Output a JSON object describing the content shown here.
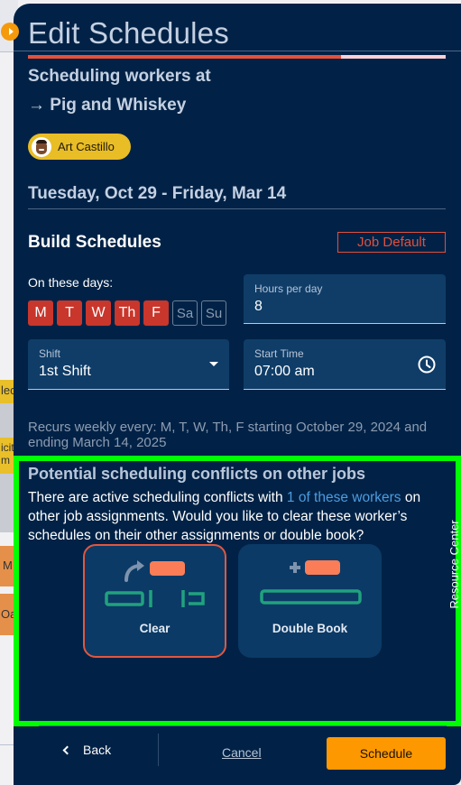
{
  "background": {
    "fragments": [
      "lec",
      "icit",
      "m",
      "M",
      "Oa"
    ]
  },
  "panel": {
    "title": "Edit Schedules",
    "progress_percent": 75,
    "subtitle_line1": "Scheduling workers at",
    "subtitle_line2": "→ Pig and Whiskey",
    "worker_chip": {
      "name": "Art Castillo"
    },
    "date_range": "Tuesday, Oct 29 - Friday, Mar 14"
  },
  "build": {
    "title": "Build Schedules",
    "job_default_label": "Job Default",
    "days_label": "On these days:",
    "days": [
      {
        "label": "M",
        "selected": true
      },
      {
        "label": "T",
        "selected": true
      },
      {
        "label": "W",
        "selected": true
      },
      {
        "label": "Th",
        "selected": true
      },
      {
        "label": "F",
        "selected": true
      },
      {
        "label": "Sa",
        "selected": false
      },
      {
        "label": "Su",
        "selected": false
      }
    ],
    "hours_per_day": {
      "label": "Hours per day",
      "value": "8"
    },
    "shift": {
      "label": "Shift",
      "value": "1st Shift"
    },
    "start_time": {
      "label": "Start Time",
      "value": "07:00 am"
    },
    "recurs_text": "Recurs weekly every: M, T, W, Th, F starting October 29, 2024 and ending March 14, 2025"
  },
  "conflicts": {
    "title": "Potential scheduling conflicts on other jobs",
    "text_before": "There are active scheduling conflicts with ",
    "link_text": "1 of these workers",
    "text_after": " on other job assignments. Would you like to clear these worker’s schedules on their other assignments or double book?",
    "options": [
      {
        "label": "Clear",
        "selected": true
      },
      {
        "label": "Double Book",
        "selected": false
      }
    ]
  },
  "resource_center_label": "Resource Center",
  "footer": {
    "back_label": "Back",
    "cancel_label": "Cancel",
    "schedule_label": "Schedule"
  },
  "colors": {
    "panel_bg": "#012246",
    "accent_red": "#e8503a",
    "day_selected": "#c9362c",
    "primary_orange": "#fd9800",
    "chip_yellow": "#e9bd26",
    "highlight_green": "#00ff00",
    "link_blue": "#4d9ce0"
  }
}
